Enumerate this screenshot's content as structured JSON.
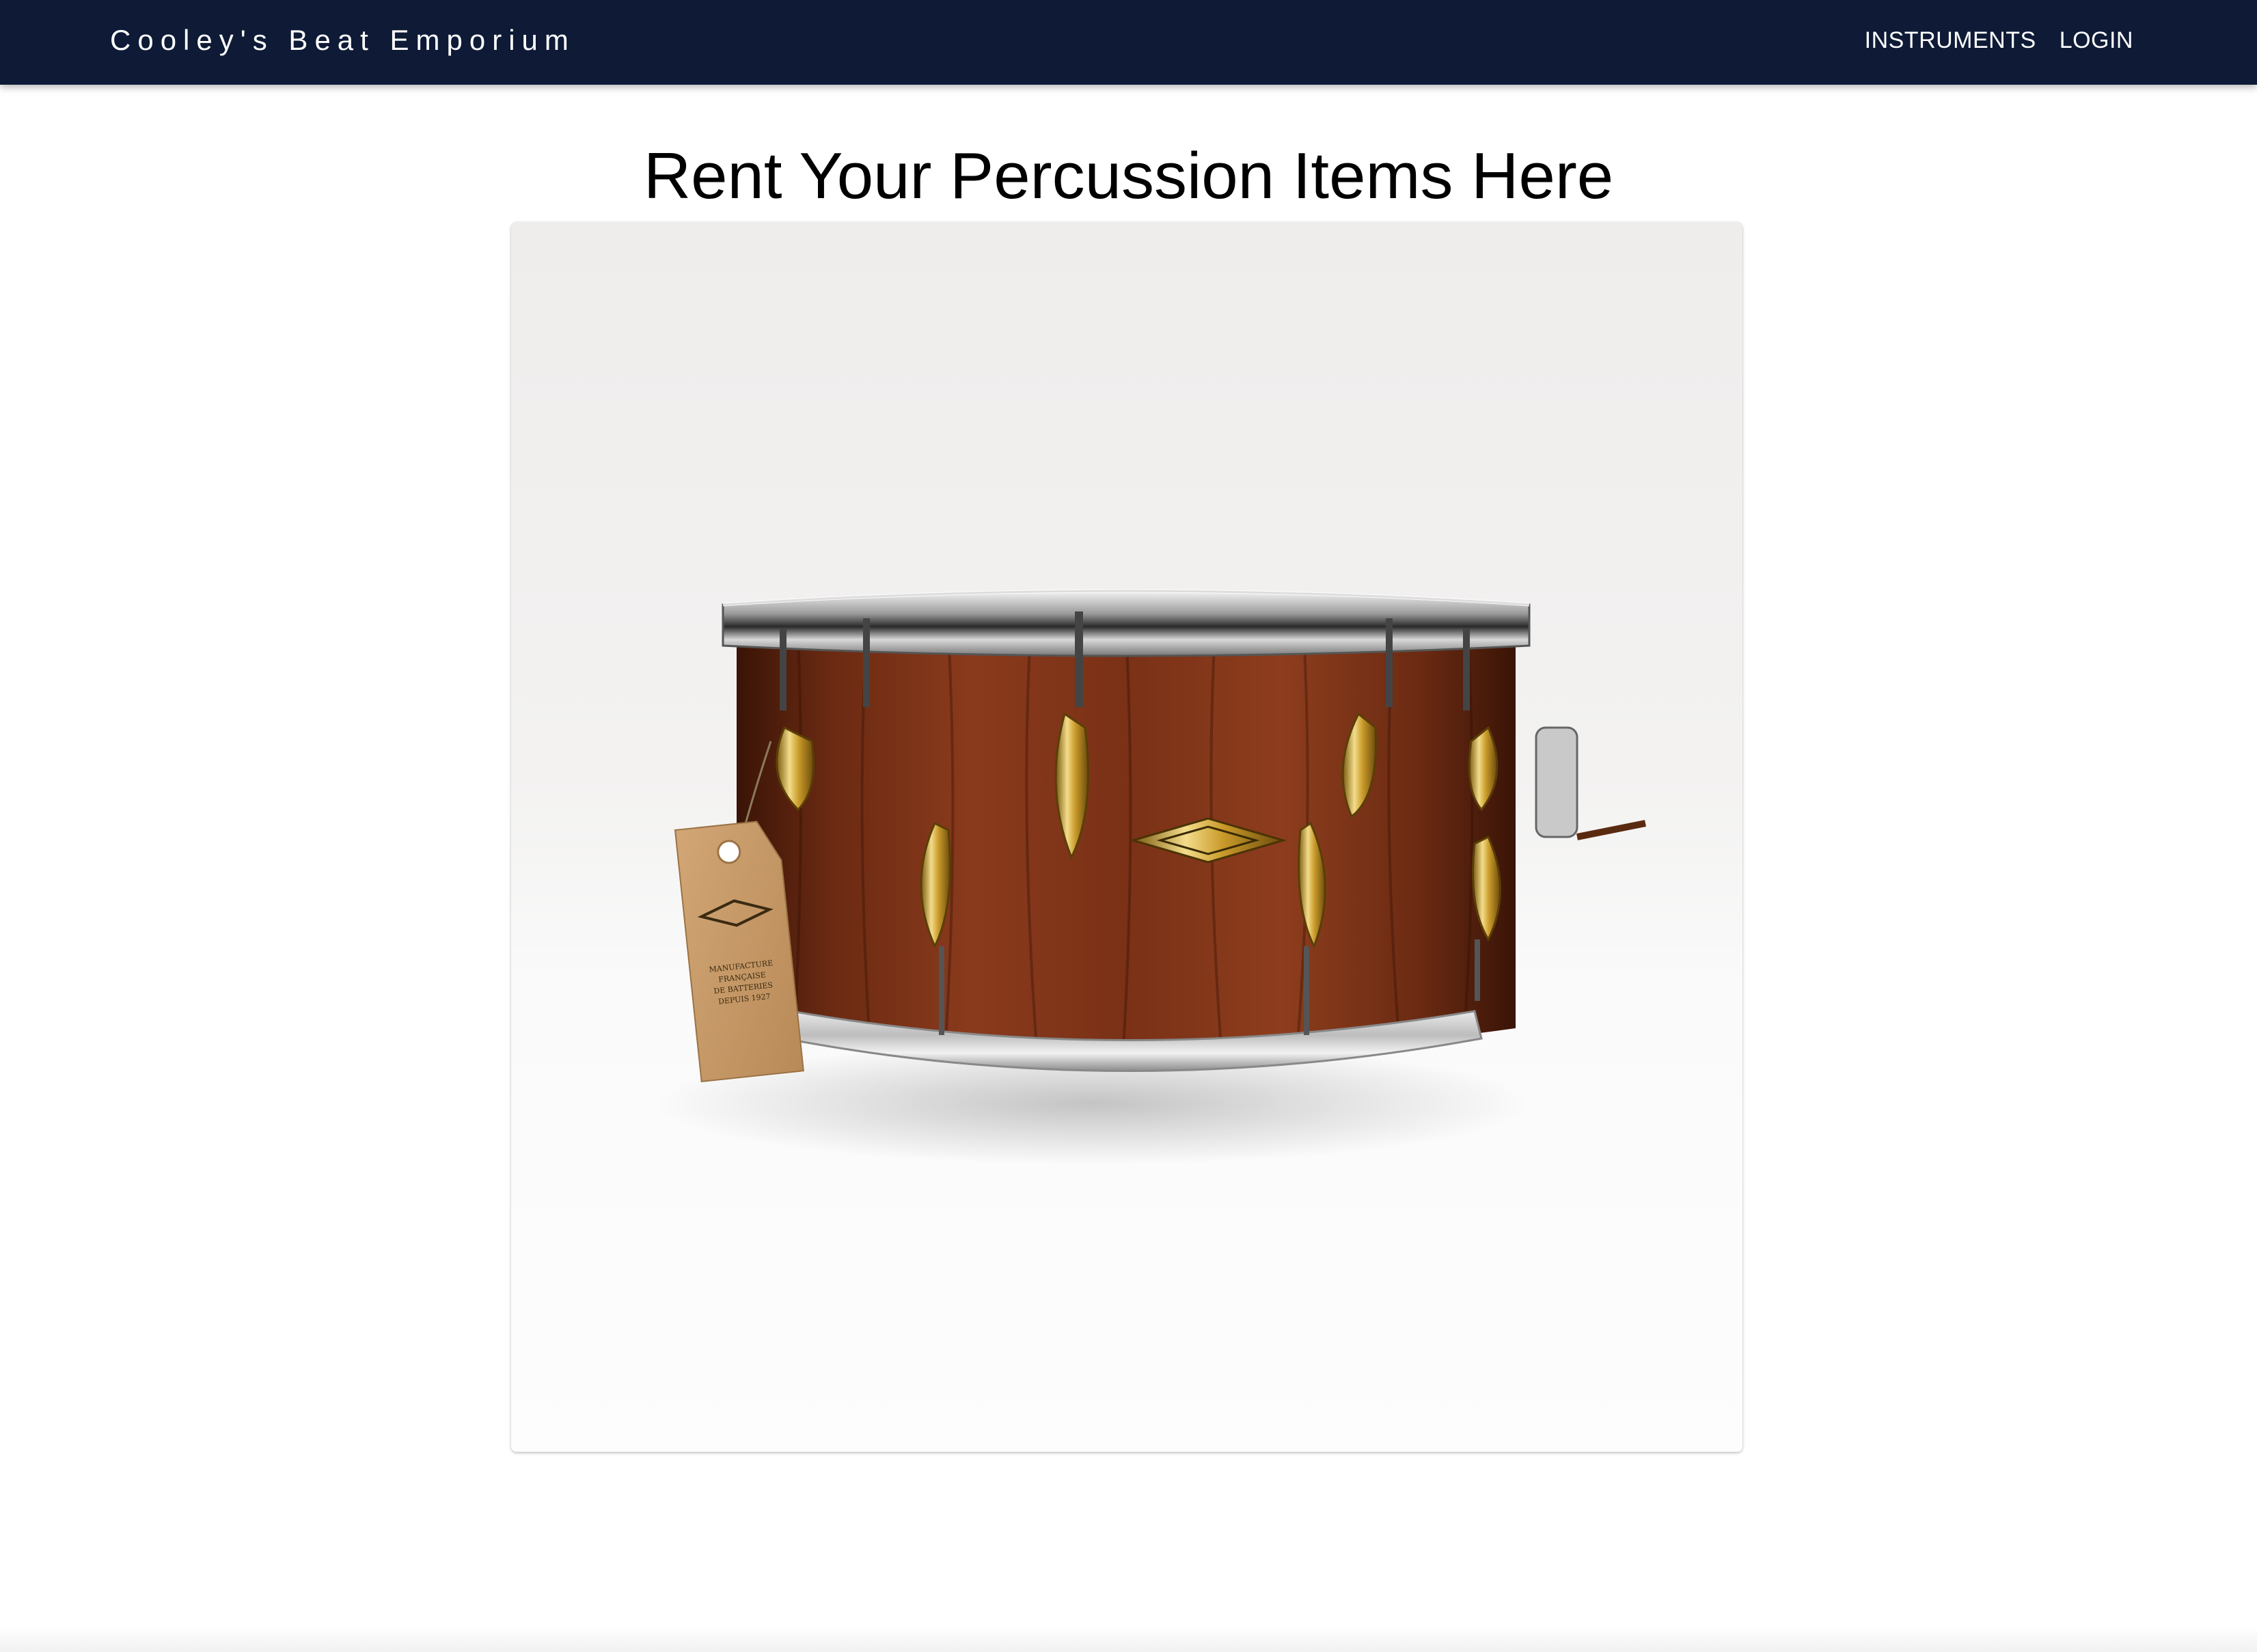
{
  "navbar": {
    "brand": "Cooley's Beat Emporium",
    "links": [
      {
        "label": "INSTRUMENTS"
      },
      {
        "label": "LOGIN"
      }
    ]
  },
  "main": {
    "title": "Rent Your Percussion Items Here",
    "image": {
      "subject": "snare drum",
      "tag_text": [
        "MANUFACTURE",
        "FRANÇAISE",
        "DE BATTERIES",
        "DEPUIS 1927"
      ]
    }
  },
  "colors": {
    "navbar_bg": "#0e1a36",
    "nav_text": "#ffffff",
    "title_text": "#000000",
    "page_bg": "#ffffff"
  }
}
